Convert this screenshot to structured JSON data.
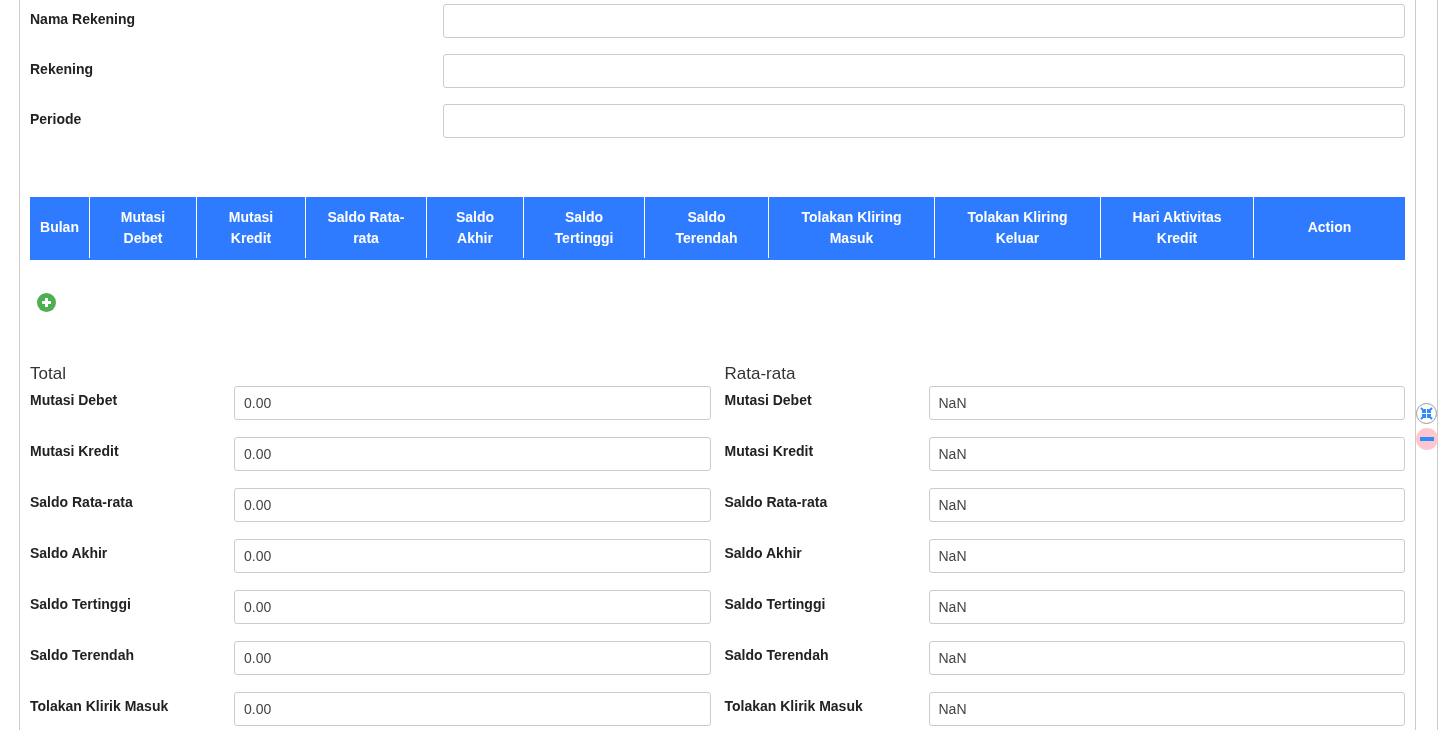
{
  "account_fields": [
    {
      "label": "Nama Rekening"
    },
    {
      "label": "Rekening"
    },
    {
      "label": "Periode"
    }
  ],
  "table": {
    "columns": [
      "Bulan",
      "Mutasi Debet",
      "Mutasi Kredit",
      "Saldo Rata-rata",
      "Saldo Akhir",
      "Saldo Tertinggi",
      "Saldo Terendah",
      "Tolakan Kliring Masuk",
      "Tolakan Kliring Keluar",
      "Hari Aktivitas Kredit",
      "Action"
    ]
  },
  "summaries": [
    {
      "title": "Total",
      "fields": [
        {
          "label": "Mutasi Debet",
          "value": "0.00"
        },
        {
          "label": "Mutasi Kredit",
          "value": "0.00"
        },
        {
          "label": "Saldo Rata-rata",
          "value": "0.00"
        },
        {
          "label": "Saldo Akhir",
          "value": "0.00"
        },
        {
          "label": "Saldo Tertinggi",
          "value": "0.00"
        },
        {
          "label": "Saldo Terendah",
          "value": "0.00"
        },
        {
          "label": "Tolakan Klirik Masuk",
          "value": "0.00"
        }
      ]
    },
    {
      "title": "Rata-rata",
      "fields": [
        {
          "label": "Mutasi Debet",
          "value": "NaN"
        },
        {
          "label": "Mutasi Kredit",
          "value": "NaN"
        },
        {
          "label": "Saldo Rata-rata",
          "value": "NaN"
        },
        {
          "label": "Saldo Akhir",
          "value": "NaN"
        },
        {
          "label": "Saldo Tertinggi",
          "value": "NaN"
        },
        {
          "label": "Saldo Terendah",
          "value": "NaN"
        },
        {
          "label": "Tolakan Klirik Masuk",
          "value": "NaN"
        }
      ]
    }
  ]
}
